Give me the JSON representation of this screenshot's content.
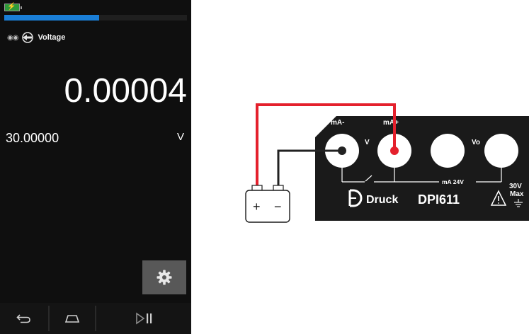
{
  "device": {
    "battery_icon": "battery-charging-icon",
    "progress_fraction": 0.52,
    "channel": {
      "status_icon": "dual-dot-icon",
      "function_icon": "voltage-input-arrow-icon",
      "label": "Voltage"
    },
    "reading": "0.00004",
    "setpoint": "30.00000",
    "unit": "V",
    "settings_icon": "gear-icon",
    "nav": {
      "back_icon": "back-arrow-icon",
      "home_icon": "home-icon",
      "play_pause_icon": "play-pause-icon"
    }
  },
  "diagram": {
    "terminals": {
      "ma_minus": "mA-",
      "ma_plus": "mA+",
      "v": "V",
      "vo": "Vo",
      "ma_24v": "mA 24V",
      "max_voltage": "30V",
      "max_label": "Max"
    },
    "brand": "Druck",
    "model": "DPI611",
    "battery": {
      "plus": "+",
      "minus": "−"
    },
    "colors": {
      "wire_red": "#e4202c",
      "wire_black": "#222222",
      "panel": "#1a1a1a"
    }
  }
}
